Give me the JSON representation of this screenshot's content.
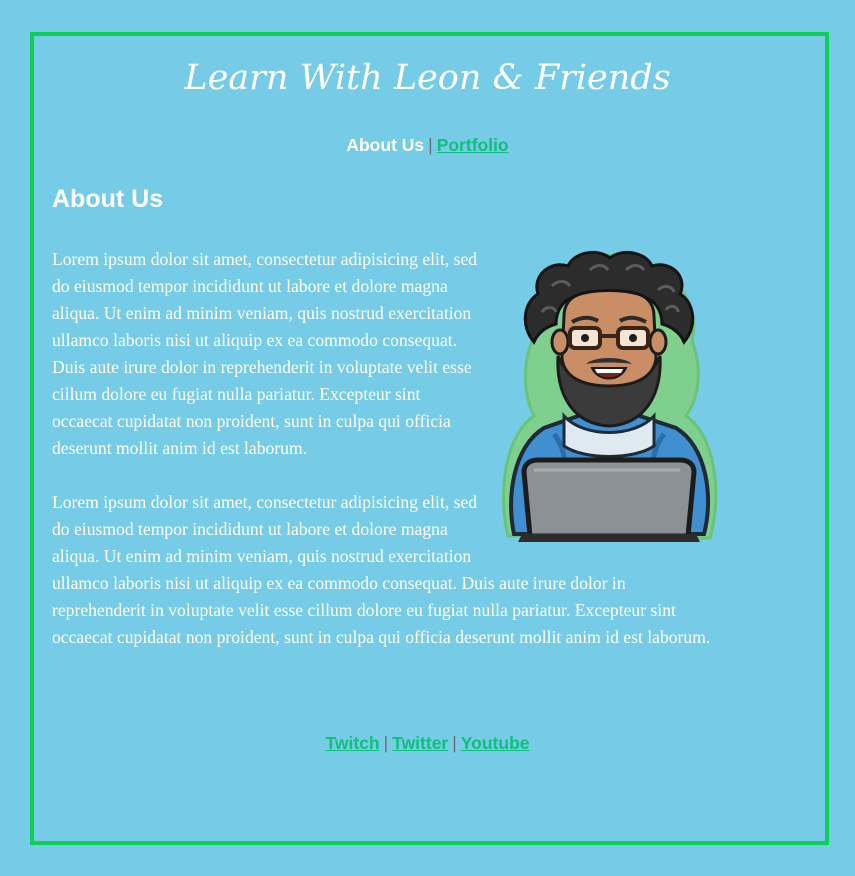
{
  "page": {
    "title": "Learn With Leon & Friends"
  },
  "top_nav": {
    "current_label": "About Us",
    "separator": "|",
    "portfolio_label": "Portfolio"
  },
  "section": {
    "heading": "About Us"
  },
  "paragraphs": [
    "Lorem ipsum dolor sit amet, consectetur adipisicing elit, sed do eiusmod tempor incididunt ut labore et dolore magna aliqua. Ut enim ad minim veniam, quis nostrud exercitation ullamco laboris nisi ut aliquip ex ea commodo consequat. Duis aute irure dolor in reprehenderit in voluptate velit esse cillum dolore eu fugiat nulla pariatur. Excepteur sint occaecat cupidatat non proident, sunt in culpa qui officia deserunt mollit anim id est laborum.",
    "Lorem ipsum dolor sit amet, consectetur adipisicing elit, sed do eiusmod tempor incididunt ut labore et dolore magna aliqua. Ut enim ad minim veniam, quis nostrud exercitation ullamco laboris nisi ut aliquip ex ea commodo consequat. Duis aute irure dolor in reprehenderit in voluptate velit esse cillum dolore eu fugiat nulla pariatur. Excepteur sint occaecat cupidatat non proident, sunt in culpa qui officia deserunt mollit anim id est laborum."
  ],
  "footer_nav": {
    "links": [
      "Twitch",
      "Twitter",
      "Youtube"
    ],
    "separator": "|"
  },
  "colors": {
    "background": "#76cbe6",
    "border": "#0dce57",
    "link": "#0fbf7c",
    "text": "#ffffff"
  },
  "icons": {
    "avatar": "bearded-coder-with-laptop-illustration"
  }
}
